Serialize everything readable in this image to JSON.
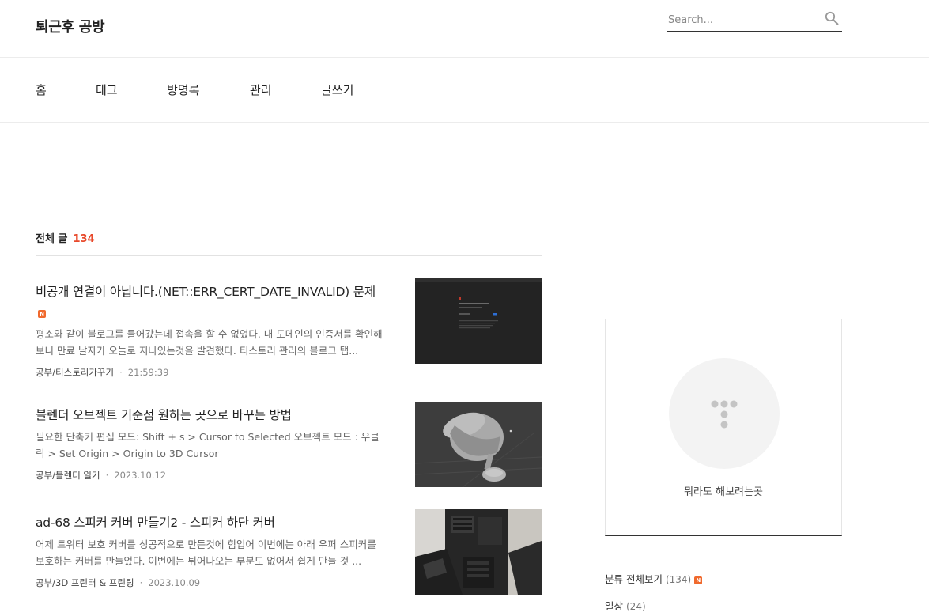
{
  "header": {
    "blog_title": "퇴근후 공방",
    "search_placeholder": "Search..."
  },
  "nav": {
    "items": [
      {
        "label": "홈"
      },
      {
        "label": "태그"
      },
      {
        "label": "방명록"
      },
      {
        "label": "관리"
      },
      {
        "label": "글쓰기"
      }
    ]
  },
  "list": {
    "heading": "전체 글",
    "count": "134"
  },
  "posts": [
    {
      "title": "비공개 연결이 아닙니다.(NET::ERR_CERT_DATE_INVALID) 문제",
      "badge": "N",
      "summary": "평소와 같이 블로그를 들어갔는데 접속을 할 수 없었다. 내 도메인의 인증서를 확인해보니 만료 날자가 오늘로 지나있는것을 발견했다. 티스토리 관리의 블로그 탭...",
      "category": "공부/티스토리가꾸기",
      "date": "21:59:39"
    },
    {
      "title": "블렌더 오브젝트 기준점 원하는 곳으로 바꾸는 방법",
      "summary": "필요한 단축키 편집 모드: Shift + s > Cursor to Selected 오브젝트 모드 : 우클릭 > Set Origin > Origin to 3D Cursor",
      "category": "공부/블렌더 일기",
      "date": "2023.10.12"
    },
    {
      "title": "ad-68 스피커 커버 만들기2 - 스피커 하단 커버",
      "summary": "어제 트위터 보호 커버를 성공적으로 만든것에 힘입어 이번에는 아래 우퍼 스피커를 보호하는 커버를 만들었다. 이번에는 튀어나오는 부분도 없어서 쉽게 만들 것 ...",
      "category": "공부/3D 프린터 & 프린팅",
      "date": "2023.10.09"
    }
  ],
  "sidebar": {
    "profile_text": "뭐라도 해보려는곳",
    "categories": [
      {
        "label": "분류 전체보기",
        "count": "(134)",
        "badge": "N"
      },
      {
        "label": "일상",
        "count": "(24)"
      }
    ]
  },
  "colors": {
    "accent": "#e8492b",
    "badge": "#f0692d"
  }
}
